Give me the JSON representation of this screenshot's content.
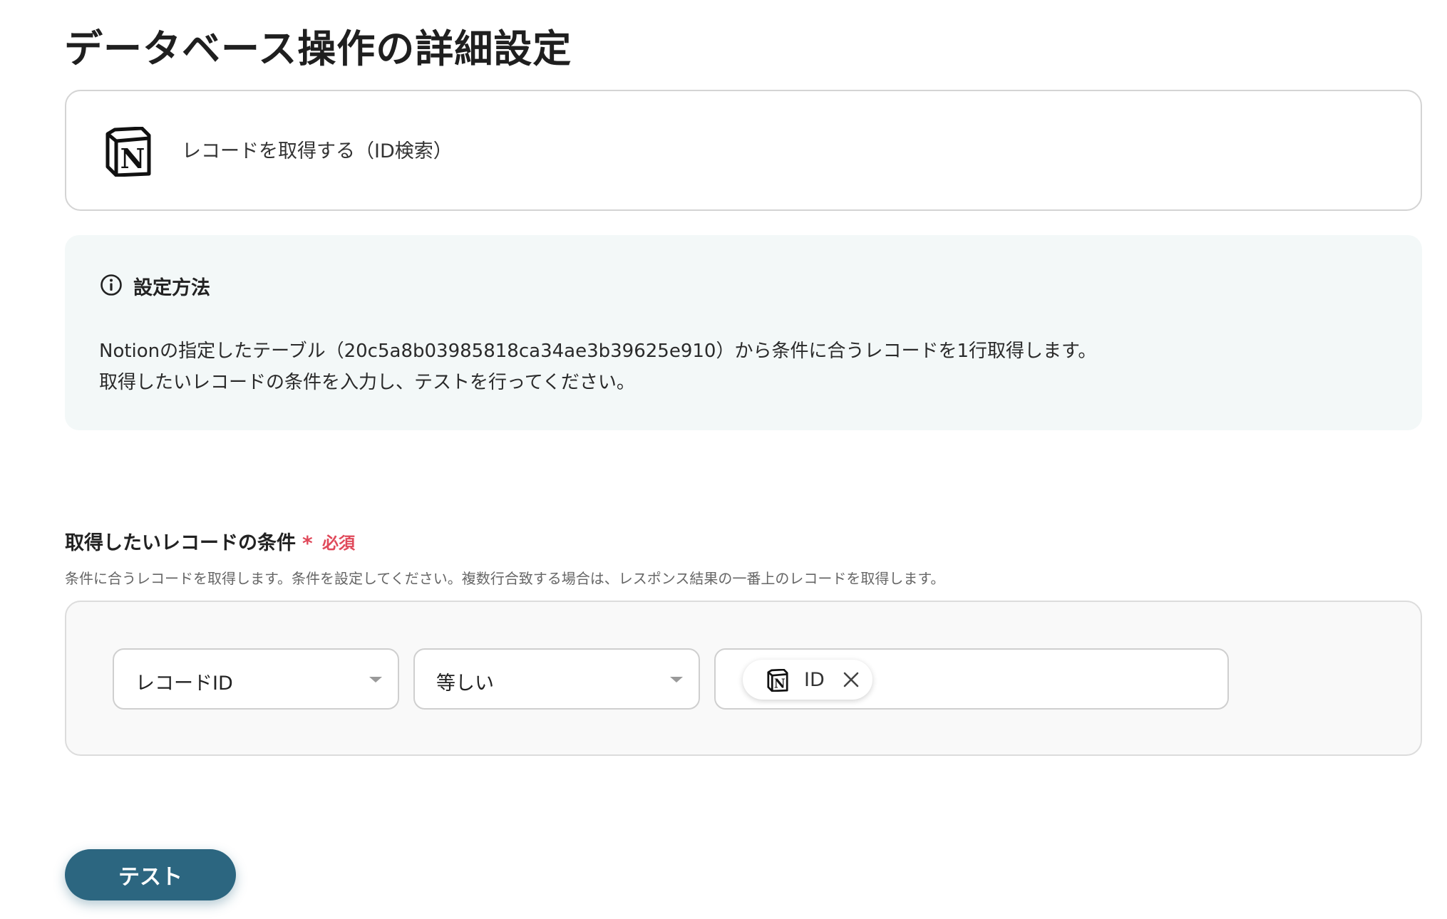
{
  "page": {
    "title": "データベース操作の詳細設定"
  },
  "action": {
    "icon": "notion-logo-icon",
    "label": "レコードを取得する（ID検索）"
  },
  "info": {
    "icon": "info-circle-icon",
    "heading": "設定方法",
    "lines": [
      "Notionの指定したテーブル（20c5a8b03985818ca34ae3b39625e910）から条件に合うレコードを1行取得します。",
      "取得したいレコードの条件を入力し、テストを行ってください。"
    ]
  },
  "condition": {
    "label": "取得したいレコードの条件",
    "required_mark": "*",
    "required_text": "必須",
    "help": "条件に合うレコードを取得します。条件を設定してください。複数行合致する場合は、レスポンス結果の一番上のレコードを取得します。",
    "field_select": "レコードID",
    "operator_select": "等しい",
    "value_chip": {
      "icon": "notion-logo-icon",
      "label": "ID",
      "remove_icon": "close-icon"
    }
  },
  "actions": {
    "test_label": "テスト"
  },
  "colors": {
    "accent": "#2c6680",
    "required": "#e0495a",
    "info_bg": "#f3f8f8"
  }
}
